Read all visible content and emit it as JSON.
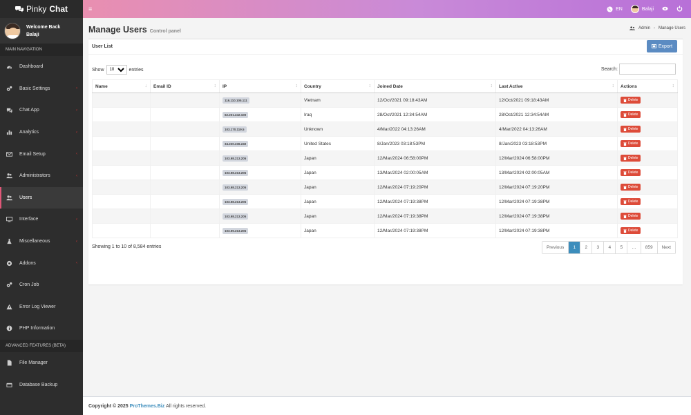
{
  "app": {
    "brand_light": "Pinky",
    "brand_bold": "Chat"
  },
  "user_panel": {
    "welcome": "Welcome Back",
    "name": "Balaji"
  },
  "nav": {
    "main_header": "MAIN NAVIGATION",
    "main_items": [
      {
        "label": "Dashboard",
        "icon": "dashboard-icon",
        "arrow": false
      },
      {
        "label": "Basic Settings",
        "icon": "cogs-icon",
        "arrow": true
      },
      {
        "label": "Chat App",
        "icon": "chat-icon",
        "arrow": true
      },
      {
        "label": "Analytics",
        "icon": "bar-chart-icon",
        "arrow": true
      },
      {
        "label": "Email Setup",
        "icon": "envelope-icon",
        "arrow": true
      },
      {
        "label": "Administrators",
        "icon": "users-icon",
        "arrow": true
      },
      {
        "label": "Users",
        "icon": "users-icon",
        "arrow": false,
        "active": true
      },
      {
        "label": "Interface",
        "icon": "monitor-icon",
        "arrow": true
      },
      {
        "label": "Miscellaneous",
        "icon": "flask-icon",
        "arrow": true
      },
      {
        "label": "Addons",
        "icon": "puzzle-icon",
        "arrow": true
      },
      {
        "label": "Cron Job",
        "icon": "cogs-icon",
        "arrow": false
      },
      {
        "label": "Error Log Viewer",
        "icon": "warning-icon",
        "arrow": false
      },
      {
        "label": "PHP Information",
        "icon": "info-icon",
        "arrow": false
      }
    ],
    "advanced_header": "ADVANCED FEATURES (BETA)",
    "advanced_items": [
      {
        "label": "File Manager",
        "icon": "file-icon",
        "arrow": false
      },
      {
        "label": "Database Backup",
        "icon": "database-icon",
        "arrow": false
      }
    ]
  },
  "topbar": {
    "menu_icon": "hamburger-icon",
    "language": "EN",
    "user": "Balaji"
  },
  "page": {
    "title": "Manage Users",
    "subtitle": "Control panel"
  },
  "breadcrumb": {
    "root": "Admin",
    "current": "Manage Users"
  },
  "box": {
    "title": "User List",
    "export_label": "Export"
  },
  "table_controls": {
    "show_label": "Show",
    "entries_label": "entries",
    "page_size": "10",
    "search_label": "Search:"
  },
  "table": {
    "headers": [
      "Name",
      "Email ID",
      "IP",
      "Country",
      "Joined Date",
      "Last Active",
      "Actions"
    ],
    "delete_label": "Delete",
    "rows": [
      {
        "name": "",
        "email": "",
        "ip": "116.110.105.111",
        "country": "Vietnam",
        "joined": "12/Oct/2021 09:18:43AM",
        "last": "12/Oct/2021 09:18:43AM"
      },
      {
        "name": "",
        "email": "",
        "ip": "62.201.242.100",
        "country": "Iraq",
        "joined": "28/Oct/2021 12:34:54AM",
        "last": "28/Oct/2021 12:34:54AM"
      },
      {
        "name": "",
        "email": "",
        "ip": "103.170.119.5",
        "country": "Unknown",
        "joined": "4/Mar/2022 04:13:26AM",
        "last": "4/Mar/2022 04:13:26AM"
      },
      {
        "name": "",
        "email": "",
        "ip": "34.220.236.240",
        "country": "United States",
        "joined": "8/Jan/2023 03:18:53PM",
        "last": "8/Jan/2023 03:18:53PM"
      },
      {
        "name": "",
        "email": "",
        "ip": "103.98.213.205",
        "country": "Japan",
        "joined": "12/Mar/2024 06:58:00PM",
        "last": "12/Mar/2024 06:58:00PM"
      },
      {
        "name": "",
        "email": "",
        "ip": "103.98.213.205",
        "country": "Japan",
        "joined": "13/Mar/2024 02:00:05AM",
        "last": "13/Mar/2024 02:00:05AM"
      },
      {
        "name": "",
        "email": "",
        "ip": "103.98.213.205",
        "country": "Japan",
        "joined": "12/Mar/2024 07:19:20PM",
        "last": "12/Mar/2024 07:19:20PM"
      },
      {
        "name": "",
        "email": "",
        "ip": "103.98.213.205",
        "country": "Japan",
        "joined": "12/Mar/2024 07:19:38PM",
        "last": "12/Mar/2024 07:19:38PM"
      },
      {
        "name": "",
        "email": "",
        "ip": "103.98.213.205",
        "country": "Japan",
        "joined": "12/Mar/2024 07:19:38PM",
        "last": "12/Mar/2024 07:19:38PM"
      },
      {
        "name": "",
        "email": "",
        "ip": "103.99.213.205",
        "country": "Japan",
        "joined": "12/Mar/2024 07:19:38PM",
        "last": "12/Mar/2024 07:19:38PM"
      }
    ]
  },
  "table_info": "Showing 1 to 10 of 8,584 entries",
  "pagination": [
    "Previous",
    "1",
    "2",
    "3",
    "4",
    "5",
    "…",
    "859",
    "Next"
  ],
  "pagination_active": "1",
  "footer": {
    "prefix": "Copyright © 2025",
    "link": "ProThemes.Biz",
    "suffix": "All rights reserved."
  },
  "colors": {
    "sidebar": "#2d2d2d",
    "active_accent": "#e05778",
    "export": "#5b8bc2",
    "delete": "#dd4b39",
    "page_active": "#3c8dbc"
  }
}
